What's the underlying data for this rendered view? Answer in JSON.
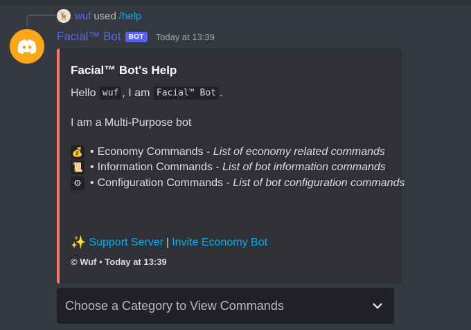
{
  "reply": {
    "username": "wuf",
    "used_text": "used",
    "command": "/help",
    "avatar_icon": "deer-avatar-icon"
  },
  "message": {
    "author": "Facial™ Bot",
    "bot_tag": "BOT",
    "timestamp": "Today at 13:39",
    "avatar_color": "#faa61a",
    "avatar_icon": "discord-logo-icon"
  },
  "embed": {
    "accent_color": "#f47b67",
    "title": "Facial™ Bot's Help",
    "hello_prefix": "Hello",
    "hello_user": "wuf",
    "hello_mid": ", I am",
    "hello_bot": "Facial™ Bot",
    "hello_suffix": ".",
    "purpose": "I am a Multi-Purpose bot",
    "commands": [
      {
        "icon": "money-bag-icon",
        "emoji": "💰",
        "name": "Economy Commands",
        "desc": "List of economy related commands"
      },
      {
        "icon": "scroll-icon",
        "emoji": "📜",
        "name": "Information Commands",
        "desc": "List of bot information commands"
      },
      {
        "icon": "gear-icon",
        "emoji": "⚙",
        "name": "Configuration Commands",
        "desc": "List of bot configuration commands"
      }
    ],
    "bullet": "•",
    "dash": "-",
    "links": {
      "sparkle": "✨",
      "support": "Support Server",
      "separator": "|",
      "invite": "Invite Economy Bot"
    },
    "footer": "© Wuf • Today at 13:39"
  },
  "select": {
    "placeholder": "Choose a Category to View Commands"
  }
}
